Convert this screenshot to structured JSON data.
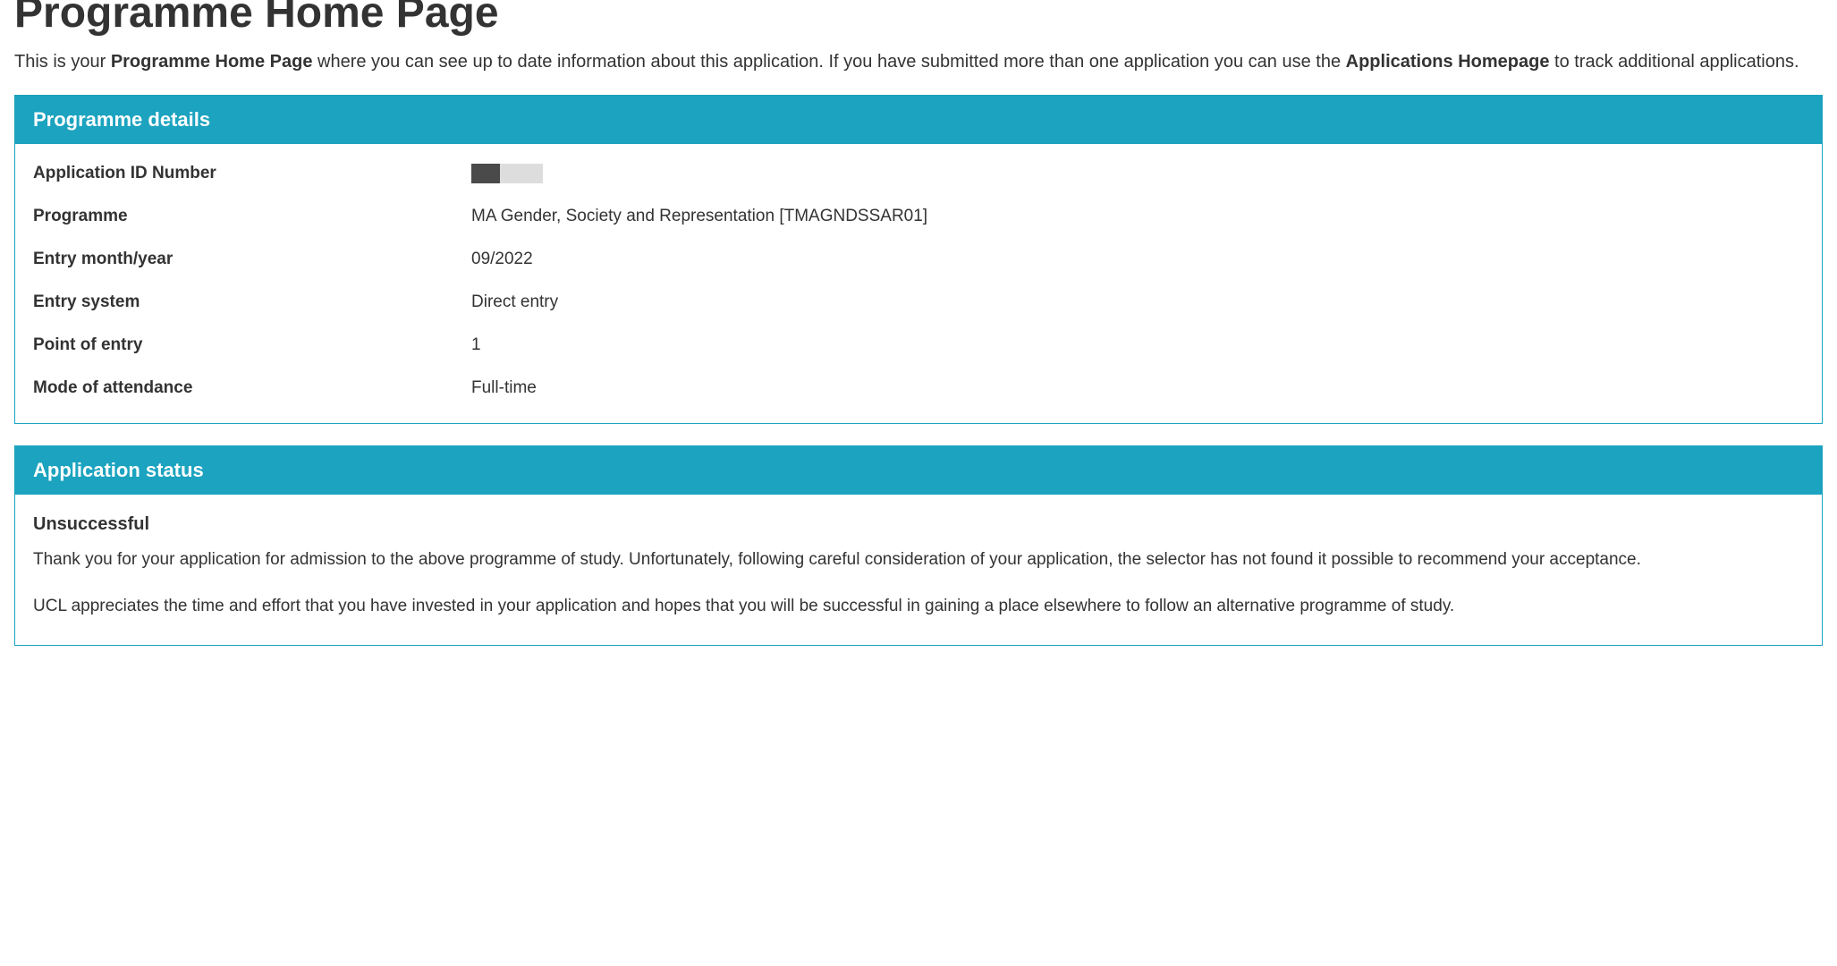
{
  "header": {
    "title": "Programme Home Page"
  },
  "intro": {
    "part1": "This is your ",
    "bold1": "Programme Home Page",
    "part2": " where you can see up to date information about this application. If you have submitted more than one application you can use the ",
    "bold2": "Applications Homepage",
    "part3": " to track additional applications."
  },
  "programme_details": {
    "panel_title": "Programme details",
    "rows": {
      "app_id_label": "Application ID Number",
      "programme_label": "Programme",
      "programme_value": "MA Gender, Society and Representation [TMAGNDSSAR01]",
      "entry_month_label": "Entry month/year",
      "entry_month_value": "09/2022",
      "entry_system_label": "Entry system",
      "entry_system_value": "Direct entry",
      "point_of_entry_label": "Point of entry",
      "point_of_entry_value": "1",
      "mode_label": "Mode of attendance",
      "mode_value": "Full-time"
    }
  },
  "application_status": {
    "panel_title": "Application status",
    "status_heading": "Unsuccessful",
    "para1": "Thank you for your application for admission to the above programme of study. Unfortunately, following careful consideration of your application, the selector has not found it possible to recommend your acceptance.",
    "para2": "UCL appreciates the time and effort that you have invested in your application and hopes that you will be successful in gaining a place elsewhere to follow an alternative programme of study."
  }
}
